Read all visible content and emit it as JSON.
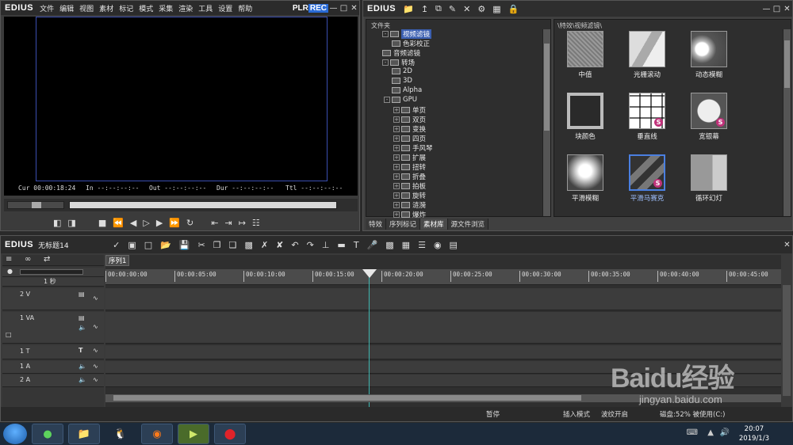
{
  "player": {
    "app_name": "EDIUS",
    "menu": [
      "文件",
      "编辑",
      "视图",
      "素材",
      "标记",
      "模式",
      "采集",
      "渲染",
      "工具",
      "设置",
      "帮助"
    ],
    "plr": "PLR",
    "rec": "REC",
    "cur_label": "Cur",
    "cur": "00:00:18:24",
    "in_label": "In",
    "in": "--:--:--:--",
    "out_label": "Out",
    "out": "--:--:--:--",
    "dur_label": "Dur",
    "dur": "--:--:--:--",
    "ttl_label": "Ttl",
    "ttl": "--:--:--:--"
  },
  "bin": {
    "app_name": "EDIUS",
    "tree_header": "文件夹",
    "tree": [
      {
        "label": "视频滤镜",
        "selected": true,
        "toggle": "-"
      },
      {
        "label": "色彩校正",
        "selected": false,
        "toggle": ""
      },
      {
        "label": "音频滤镜",
        "selected": false,
        "toggle": ""
      },
      {
        "label": "转场",
        "selected": false,
        "toggle": "-"
      },
      {
        "label": "2D",
        "selected": false,
        "toggle": ""
      },
      {
        "label": "3D",
        "selected": false,
        "toggle": ""
      },
      {
        "label": "Alpha",
        "selected": false,
        "toggle": ""
      },
      {
        "label": "GPU",
        "selected": false,
        "toggle": "-"
      },
      {
        "label": "单页",
        "selected": false,
        "toggle": "+"
      },
      {
        "label": "双页",
        "selected": false,
        "toggle": "+"
      },
      {
        "label": "变换",
        "selected": false,
        "toggle": "+"
      },
      {
        "label": "四页",
        "selected": false,
        "toggle": "+"
      },
      {
        "label": "手风琴",
        "selected": false,
        "toggle": "+"
      },
      {
        "label": "扩展",
        "selected": false,
        "toggle": "+"
      },
      {
        "label": "扭转",
        "selected": false,
        "toggle": "+"
      },
      {
        "label": "折叠",
        "selected": false,
        "toggle": "+"
      },
      {
        "label": "拍板",
        "selected": false,
        "toggle": "+"
      },
      {
        "label": "旋转",
        "selected": false,
        "toggle": "+"
      },
      {
        "label": "涟漪",
        "selected": false,
        "toggle": "+"
      },
      {
        "label": "爆炸",
        "selected": false,
        "toggle": "+"
      }
    ],
    "path": "\\特效\\视频滤镜\\",
    "clips": [
      {
        "name": "中值",
        "selected": false
      },
      {
        "name": "光栅滚动",
        "selected": false
      },
      {
        "name": "动态模糊",
        "selected": false
      },
      {
        "name": "块颜色",
        "selected": false
      },
      {
        "name": "垂直线",
        "selected": false
      },
      {
        "name": "宽银幕",
        "selected": false
      },
      {
        "name": "平滑模糊",
        "selected": false
      },
      {
        "name": "平滑马赛克",
        "selected": true
      },
      {
        "name": "循环幻灯",
        "selected": false
      }
    ],
    "tabs": [
      "特效",
      "序列标记",
      "素材库",
      "源文件浏览"
    ]
  },
  "timeline": {
    "app_name": "EDIUS",
    "project": "无标题14",
    "sequence_tab": "序列1",
    "zoom": "1 秒",
    "ruler": [
      "00:00:00:00",
      "00:00:05:00",
      "00:00:10:00",
      "00:00:15:00",
      "00:00:20:00",
      "00:00:25:00",
      "00:00:30:00",
      "00:00:35:00",
      "00:00:40:00",
      "00:00:45:00"
    ],
    "tracks": [
      {
        "label": "2 V"
      },
      {
        "label": "1 VA"
      },
      {
        "label": "1 T"
      },
      {
        "label": "1 A"
      },
      {
        "label": "2 A"
      }
    ],
    "status": [
      "暂停",
      "插入模式",
      "波纹开启",
      "磁盘:52% 被使用(C:)"
    ]
  },
  "taskbar": {
    "time": "20:07",
    "date": "2019/1/3"
  },
  "watermark": {
    "brand": "Baidu经验",
    "url": "jingyan.baidu.com"
  }
}
